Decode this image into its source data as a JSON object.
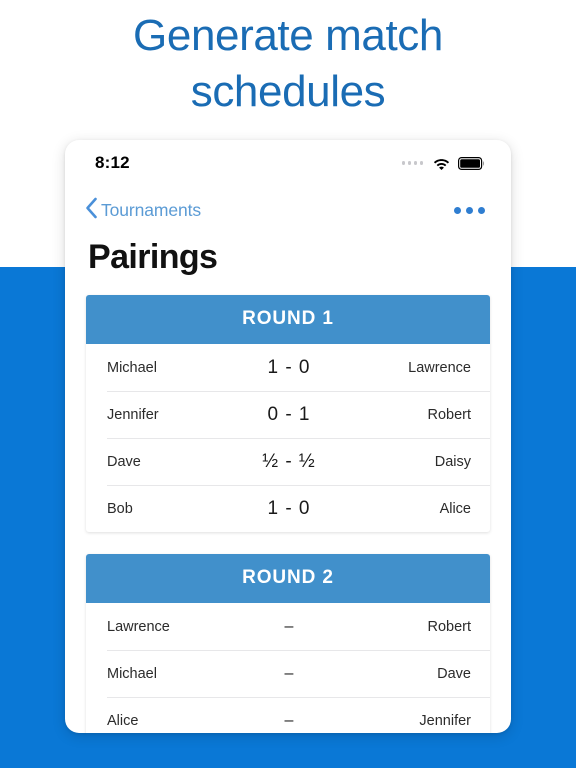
{
  "promo": {
    "headline_line1": "Generate match",
    "headline_line2": "schedules",
    "headline_color": "#1a6cb4",
    "background_color": "#0a78d6"
  },
  "status_bar": {
    "time": "8:12",
    "cellular_icon": "signal-dots-icon",
    "wifi_icon": "wifi-icon",
    "battery_icon": "battery-full-icon"
  },
  "nav_bar": {
    "back_icon": "chevron-left-icon",
    "back_label": "Tournaments",
    "more_icon": "more-horizontal-icon",
    "accent_color": "#5b9bd5"
  },
  "screen": {
    "title": "Pairings",
    "round_header_color": "#4190cb"
  },
  "rounds": [
    {
      "title": "ROUND 1",
      "matches": [
        {
          "white": "Michael",
          "score": "1 - 0",
          "black": "Lawrence"
        },
        {
          "white": "Jennifer",
          "score": "0 - 1",
          "black": "Robert"
        },
        {
          "white": "Dave",
          "score": "½ - ½",
          "black": "Daisy"
        },
        {
          "white": "Bob",
          "score": "1 - 0",
          "black": "Alice"
        }
      ]
    },
    {
      "title": "ROUND 2",
      "matches": [
        {
          "white": "Lawrence",
          "score": "–",
          "black": "Robert"
        },
        {
          "white": "Michael",
          "score": "–",
          "black": "Dave"
        },
        {
          "white": "Alice",
          "score": "–",
          "black": "Jennifer"
        }
      ]
    }
  ]
}
